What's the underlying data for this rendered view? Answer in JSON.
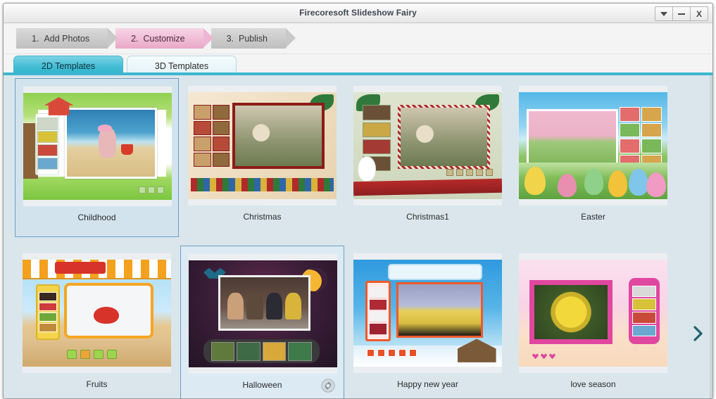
{
  "window": {
    "title": "Firecoresoft Slideshow Fairy",
    "controls": [
      {
        "name": "dropdown-button",
        "glyph": "▼"
      },
      {
        "name": "minimize-button",
        "glyph": "–"
      },
      {
        "name": "close-button",
        "glyph": "X"
      }
    ]
  },
  "steps": [
    {
      "num": "1.",
      "label": "Add Photos",
      "active": false
    },
    {
      "num": "2.",
      "label": "Customize",
      "active": true
    },
    {
      "num": "3.",
      "label": "Publish",
      "active": false
    }
  ],
  "tabs": [
    {
      "label": "2D Templates",
      "active": true
    },
    {
      "label": "3D Templates",
      "active": false
    }
  ],
  "templates": [
    {
      "name": "Childhood",
      "state": "selected",
      "gear": false
    },
    {
      "name": "Christmas",
      "state": "normal",
      "gear": false
    },
    {
      "name": "Christmas1",
      "state": "normal",
      "gear": false
    },
    {
      "name": "Easter",
      "state": "normal",
      "gear": false
    },
    {
      "name": "Fruits",
      "state": "normal",
      "gear": false
    },
    {
      "name": "Halloween",
      "state": "hover",
      "gear": true
    },
    {
      "name": "Happy new year",
      "state": "normal",
      "gear": false
    },
    {
      "name": "love season",
      "state": "normal",
      "gear": false
    }
  ],
  "nav": {
    "next_label": "›"
  },
  "colors": {
    "accent_cyan": "#3cb7cf",
    "active_step_pink": "#eaa8c8",
    "content_bg": "#dae6ec",
    "selection_border": "#6e9fc2"
  }
}
